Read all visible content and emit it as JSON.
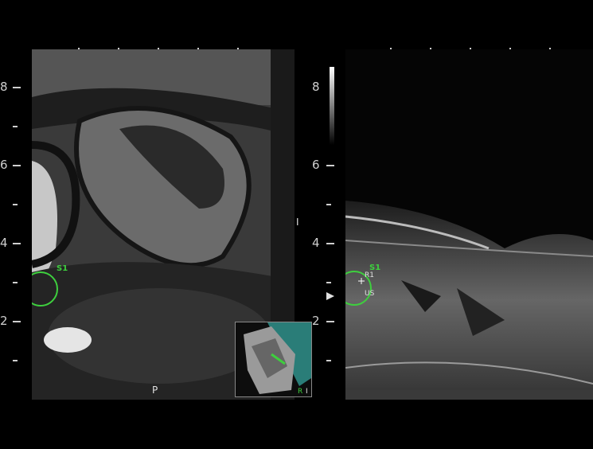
{
  "viewer": {
    "left_scale": {
      "labels": [
        "8",
        "6",
        "4",
        "2"
      ]
    },
    "right_scale": {
      "labels": [
        "8",
        "6",
        "4",
        "2"
      ]
    },
    "mri": {
      "marker_label": "S1",
      "orientation_label": "P"
    },
    "ultrasound": {
      "marker_label": "S1",
      "point_label": "R1",
      "point_sub_label": "US"
    },
    "overview": {
      "labels": [
        "R",
        "I"
      ]
    },
    "divider_label": "I",
    "colors": {
      "marker": "#3ecf3e",
      "overview_plane": "#2a7d78",
      "background": "#000000"
    }
  }
}
